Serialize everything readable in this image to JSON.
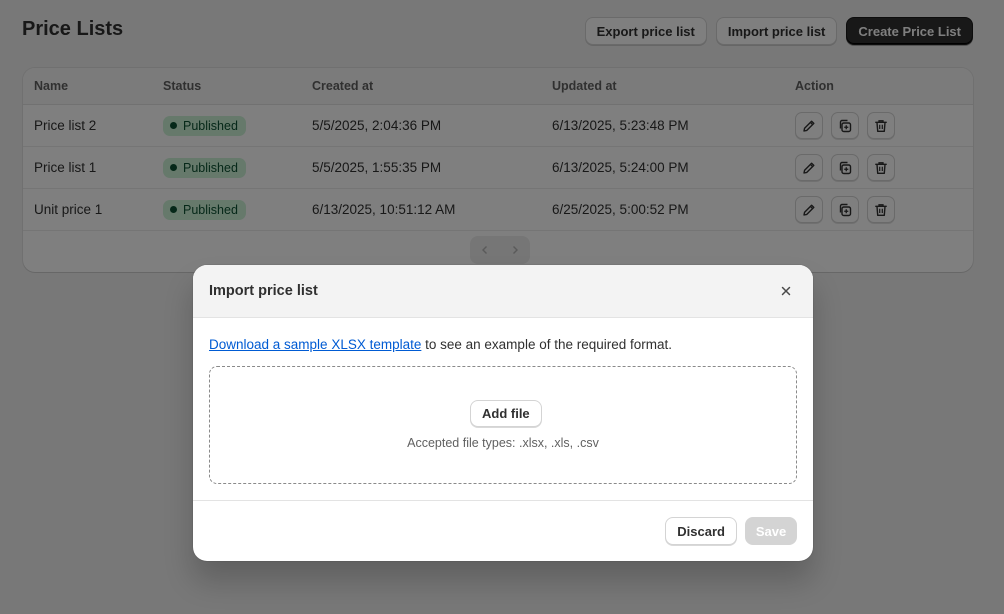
{
  "page": {
    "title": "Price Lists",
    "actions": {
      "export_label": "Export price list",
      "import_label": "Import price list",
      "create_label": "Create Price List"
    }
  },
  "table": {
    "headers": [
      "Name",
      "Status",
      "Created at",
      "Updated at",
      "Action"
    ],
    "rows": [
      {
        "name": "Price list 2",
        "status": "Published",
        "created": "5/5/2025, 2:04:36 PM",
        "updated": "6/13/2025, 5:23:48 PM"
      },
      {
        "name": "Price list 1",
        "status": "Published",
        "created": "5/5/2025, 1:55:35 PM",
        "updated": "6/13/2025, 5:24:00 PM"
      },
      {
        "name": "Unit price 1",
        "status": "Published",
        "created": "6/13/2025, 10:51:12 AM",
        "updated": "6/25/2025, 5:00:52 PM"
      }
    ],
    "row_actions": [
      "edit-icon",
      "duplicate-icon",
      "trash-icon"
    ]
  },
  "pagination": {
    "icons": [
      "chevron-left-icon",
      "chevron-right-icon"
    ]
  },
  "modal": {
    "title": "Import price list",
    "link_text": "Download a sample XLSX template",
    "help_text": " to see an example of the required format.",
    "add_file_label": "Add file",
    "accepted_text": "Accepted file types: .xlsx, .xls, .csv",
    "discard_label": "Discard",
    "save_label": "Save"
  },
  "colors": {
    "primary_button": "#303030",
    "badge_bg": "#cdf3d6",
    "badge_text": "#0c5132",
    "link": "#005bd3",
    "overlay": "rgba(0,0,0,0.5)"
  }
}
